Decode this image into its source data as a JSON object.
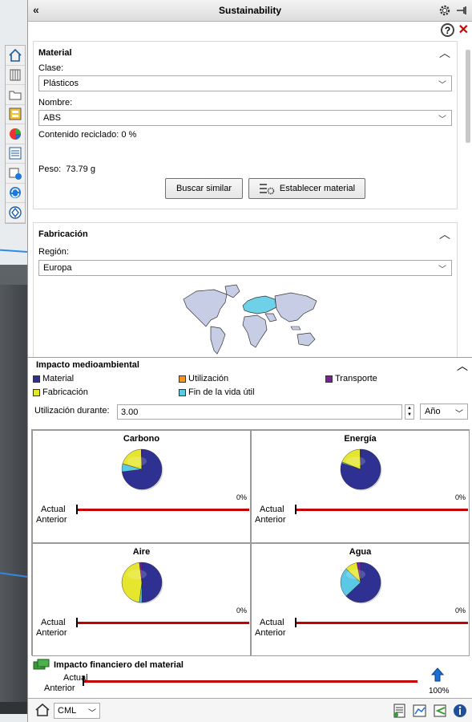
{
  "panel": {
    "title": "Sustainability",
    "collapse_glyph": "«"
  },
  "material": {
    "section_title": "Material",
    "class_label": "Clase:",
    "class_value": "Plásticos",
    "name_label": "Nombre:",
    "name_value": "ABS",
    "recycled": "Contenido reciclado: 0 %",
    "weight_label": "Peso:",
    "weight_value": "73.79 g",
    "find_similar": "Buscar similar",
    "set_material": "Establecer material"
  },
  "manufacturing": {
    "section_title": "Fabricación",
    "region_label": "Región:",
    "region_value": "Europa"
  },
  "environment": {
    "section_title": "Impacto medioambiental",
    "legend": [
      {
        "label": "Material",
        "color": "#2e3192"
      },
      {
        "label": "Utilización",
        "color": "#f7941d"
      },
      {
        "label": "Transporte",
        "color": "#7b1fa2"
      },
      {
        "label": "Fabricación",
        "color": "#e6e62e"
      },
      {
        "label": "Fin de la vida útil",
        "color": "#5bc8e6"
      }
    ],
    "usage_label": "Utilización durante:",
    "usage_value": "3.00",
    "usage_unit": "Año",
    "charts": [
      {
        "title": "Carbono",
        "pct": "0%",
        "actual": "Actual",
        "previous": "Anterior",
        "slices": [
          0.73,
          0.0,
          0.005,
          0.2,
          0.065
        ]
      },
      {
        "title": "Energía",
        "pct": "0%",
        "actual": "Actual",
        "previous": "Anterior",
        "slices": [
          0.8,
          0.0,
          0.005,
          0.185,
          0.01
        ]
      },
      {
        "title": "Aire",
        "pct": "0%",
        "actual": "Actual",
        "previous": "Anterior",
        "slices": [
          0.5,
          0.0,
          0.02,
          0.46,
          0.02
        ]
      },
      {
        "title": "Agua",
        "pct": "0%",
        "actual": "Actual",
        "previous": "Anterior",
        "slices": [
          0.63,
          0.0,
          0.03,
          0.1,
          0.24
        ]
      }
    ]
  },
  "financial": {
    "title": "Impacto financiero del material",
    "actual": "Actual",
    "previous": "Anterior",
    "pct": "100%"
  },
  "footer": {
    "standard": "CML"
  }
}
